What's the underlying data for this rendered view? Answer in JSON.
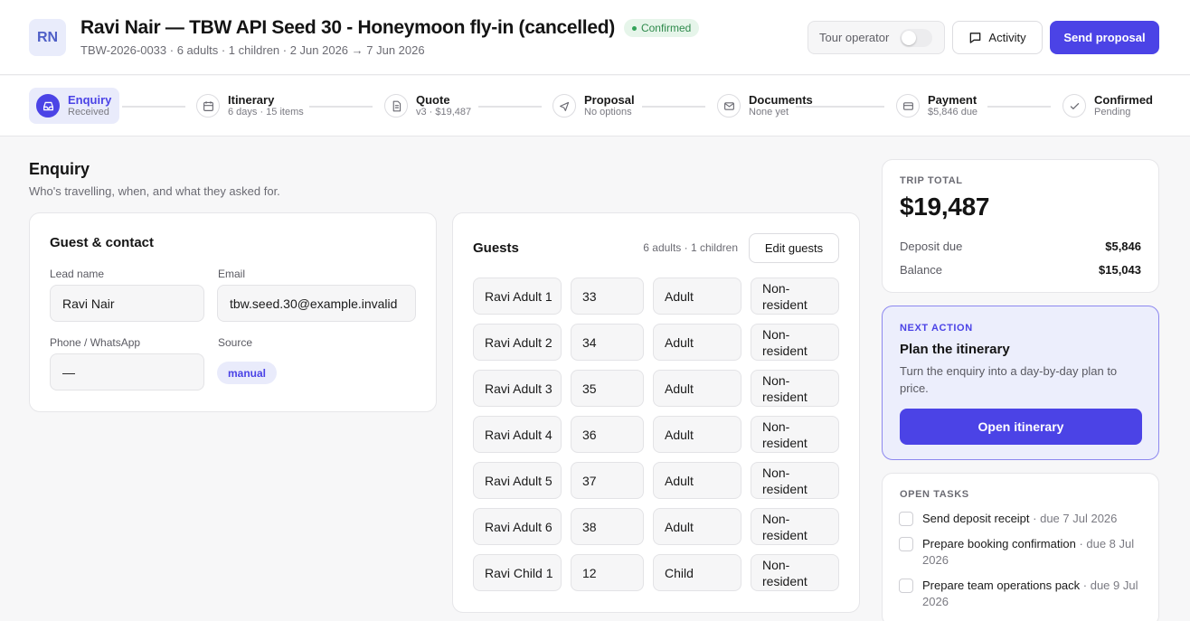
{
  "header": {
    "avatar": "RN",
    "title": "Ravi Nair — TBW API Seed 30 - Honeymoon fly-in (cancelled)",
    "status": "Confirmed",
    "subtitle": "TBW-2026-0033 · 6 adults · 1 children · 2 Jun 2026 → 7 Jun 2026",
    "tour_operator_label": "Tour operator",
    "tour_operator_on": false,
    "activity_label": "Activity",
    "send_proposal_label": "Send proposal"
  },
  "stepper": [
    {
      "label": "Enquiry",
      "sub": "Received",
      "icon": "inbox-icon",
      "active": true
    },
    {
      "label": "Itinerary",
      "sub": "6 days · 15 items",
      "icon": "calendar-icon",
      "active": false
    },
    {
      "label": "Quote",
      "sub": "v3 · $19,487",
      "icon": "document-icon",
      "active": false
    },
    {
      "label": "Proposal",
      "sub": "No options",
      "icon": "send-icon",
      "active": false
    },
    {
      "label": "Documents",
      "sub": "None yet",
      "icon": "mail-icon",
      "active": false
    },
    {
      "label": "Payment",
      "sub": "$5,846 due",
      "icon": "credit-card-icon",
      "active": false
    },
    {
      "label": "Confirmed",
      "sub": "Pending",
      "icon": "check-icon",
      "active": false
    }
  ],
  "section": {
    "title": "Enquiry",
    "subtitle": "Who's travelling, when, and what they asked for."
  },
  "contact": {
    "title": "Guest & contact",
    "lead_name_label": "Lead name",
    "lead_name": "Ravi Nair",
    "email_label": "Email",
    "email": "tbw.seed.30@example.invalid",
    "phone_label": "Phone / WhatsApp",
    "phone": "—",
    "source_label": "Source",
    "source": "manual"
  },
  "guests": {
    "title": "Guests",
    "count": "6 adults · 1 children",
    "edit_label": "Edit guests",
    "rows": [
      {
        "name": "Ravi Adult 1",
        "age": "33",
        "type": "Adult",
        "residency": "Non-resident"
      },
      {
        "name": "Ravi Adult 2",
        "age": "34",
        "type": "Adult",
        "residency": "Non-resident"
      },
      {
        "name": "Ravi Adult 3",
        "age": "35",
        "type": "Adult",
        "residency": "Non-resident"
      },
      {
        "name": "Ravi Adult 4",
        "age": "36",
        "type": "Adult",
        "residency": "Non-resident"
      },
      {
        "name": "Ravi Adult 5",
        "age": "37",
        "type": "Adult",
        "residency": "Non-resident"
      },
      {
        "name": "Ravi Adult 6",
        "age": "38",
        "type": "Adult",
        "residency": "Non-resident"
      },
      {
        "name": "Ravi Child 1",
        "age": "12",
        "type": "Child",
        "residency": "Non-resident"
      }
    ]
  },
  "trip_total": {
    "label": "TRIP TOTAL",
    "value": "$19,487",
    "deposit_label": "Deposit due",
    "deposit": "$5,846",
    "balance_label": "Balance",
    "balance": "$15,043"
  },
  "next_action": {
    "label": "NEXT ACTION",
    "title": "Plan the itinerary",
    "description": "Turn the enquiry into a day-by-day plan to price.",
    "button": "Open itinerary"
  },
  "open_tasks": {
    "label": "OPEN TASKS",
    "tasks": [
      {
        "text": "Send deposit receipt",
        "due": " · due 7 Jul 2026"
      },
      {
        "text": "Prepare booking confirmation",
        "due": " · due 8 Jul 2026"
      },
      {
        "text": "Prepare team operations pack",
        "due": " · due 9 Jul 2026"
      }
    ]
  },
  "colors": {
    "accent": "#4b43e6",
    "success": "#2f8a4c"
  }
}
